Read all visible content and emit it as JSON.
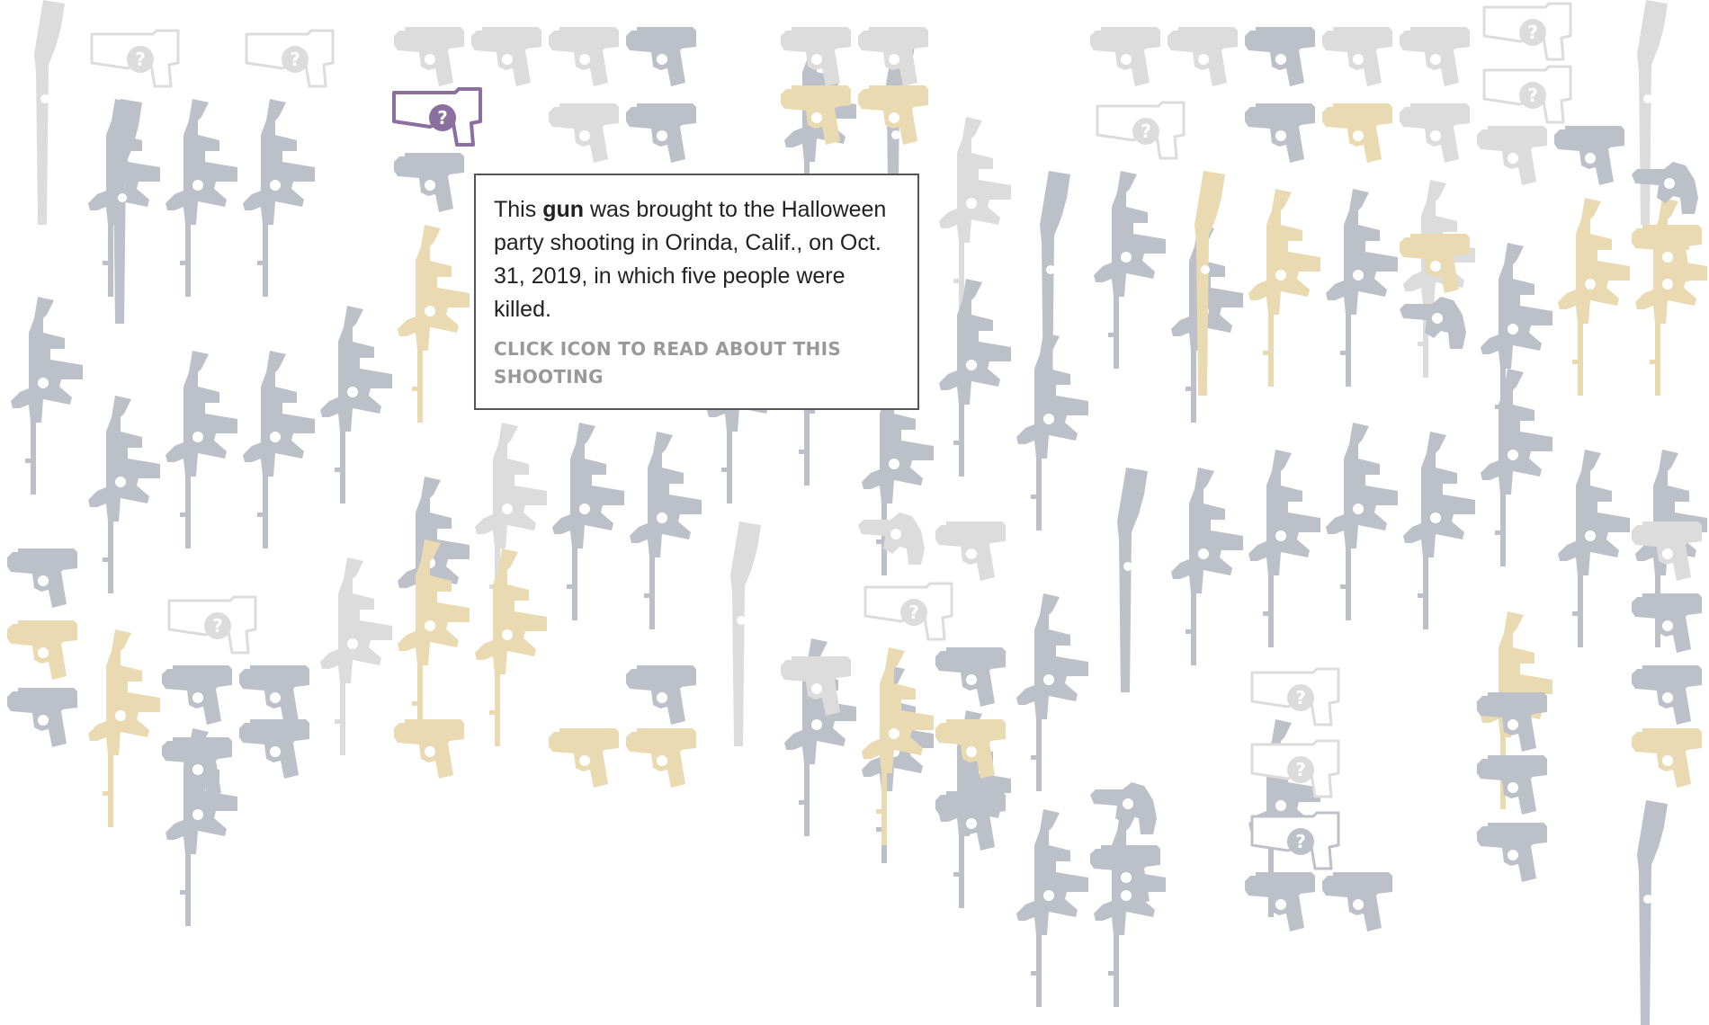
{
  "colors": {
    "rifle": "#bcc0c8",
    "pistol": "#bcc0c8",
    "revolver": "#bcc0c8",
    "unknown": "#dcdcdc",
    "highlight": "#e9dab1",
    "selected": "#8a6fa0",
    "tooltip_border": "#555555",
    "cta": "#999999"
  },
  "icons": {
    "rifle": "rifle-icon",
    "pistol": "pistol-icon",
    "revolver": "revolver-icon",
    "unknown": "unknown-gun-icon",
    "question_mark": "question-mark-icon"
  },
  "tooltip": {
    "prefix": "This ",
    "weapon": "gun",
    "suffix": " was brought to the Halloween party shooting in Orinda, Calif., on Oct. 31, 2019, in which five people were killed.",
    "cta": "Click icon to read about this shooting"
  },
  "selected_gun": {
    "type": "unknown",
    "shooting": "Orinda, Calif.",
    "date": "Oct. 31, 2019",
    "killed": 5
  }
}
